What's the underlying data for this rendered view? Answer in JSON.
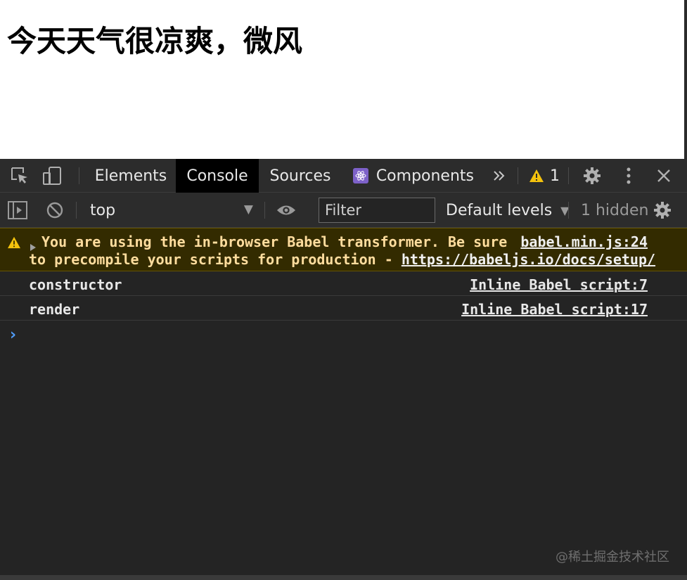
{
  "page": {
    "heading": "今天天气很凉爽，微风"
  },
  "devtools": {
    "tabs": [
      {
        "label": "Elements"
      },
      {
        "label": "Console"
      },
      {
        "label": "Sources"
      },
      {
        "label": "Components"
      }
    ],
    "active_tab": "Console",
    "warnings_count": "1",
    "console_toolbar": {
      "context": "top",
      "filter_placeholder": "Filter",
      "levels": "Default levels",
      "hidden": "1 hidden"
    },
    "messages": [
      {
        "level": "warning",
        "line1": "You are using the in-browser Babel transformer. Be sure",
        "line2_text": "to precompile your scripts for production - ",
        "line2_link": "https://babeljs.io/docs/setup/",
        "source": "babel.min.js:24"
      },
      {
        "level": "log",
        "text": "constructor",
        "source": "Inline Babel script:7"
      },
      {
        "level": "log",
        "text": "render",
        "source": "Inline Babel script:17"
      }
    ],
    "prompt_symbol": "›"
  },
  "watermark": "@稀土掘金技术社区",
  "colors": {
    "panel_bg": "#242424",
    "toolbar_bg": "#2c2c2c",
    "warning_bg": "#332b00",
    "warning_text": "#ffdd9e",
    "prompt_blue": "#4f9cf8",
    "react_purple": "#7d61c9"
  }
}
